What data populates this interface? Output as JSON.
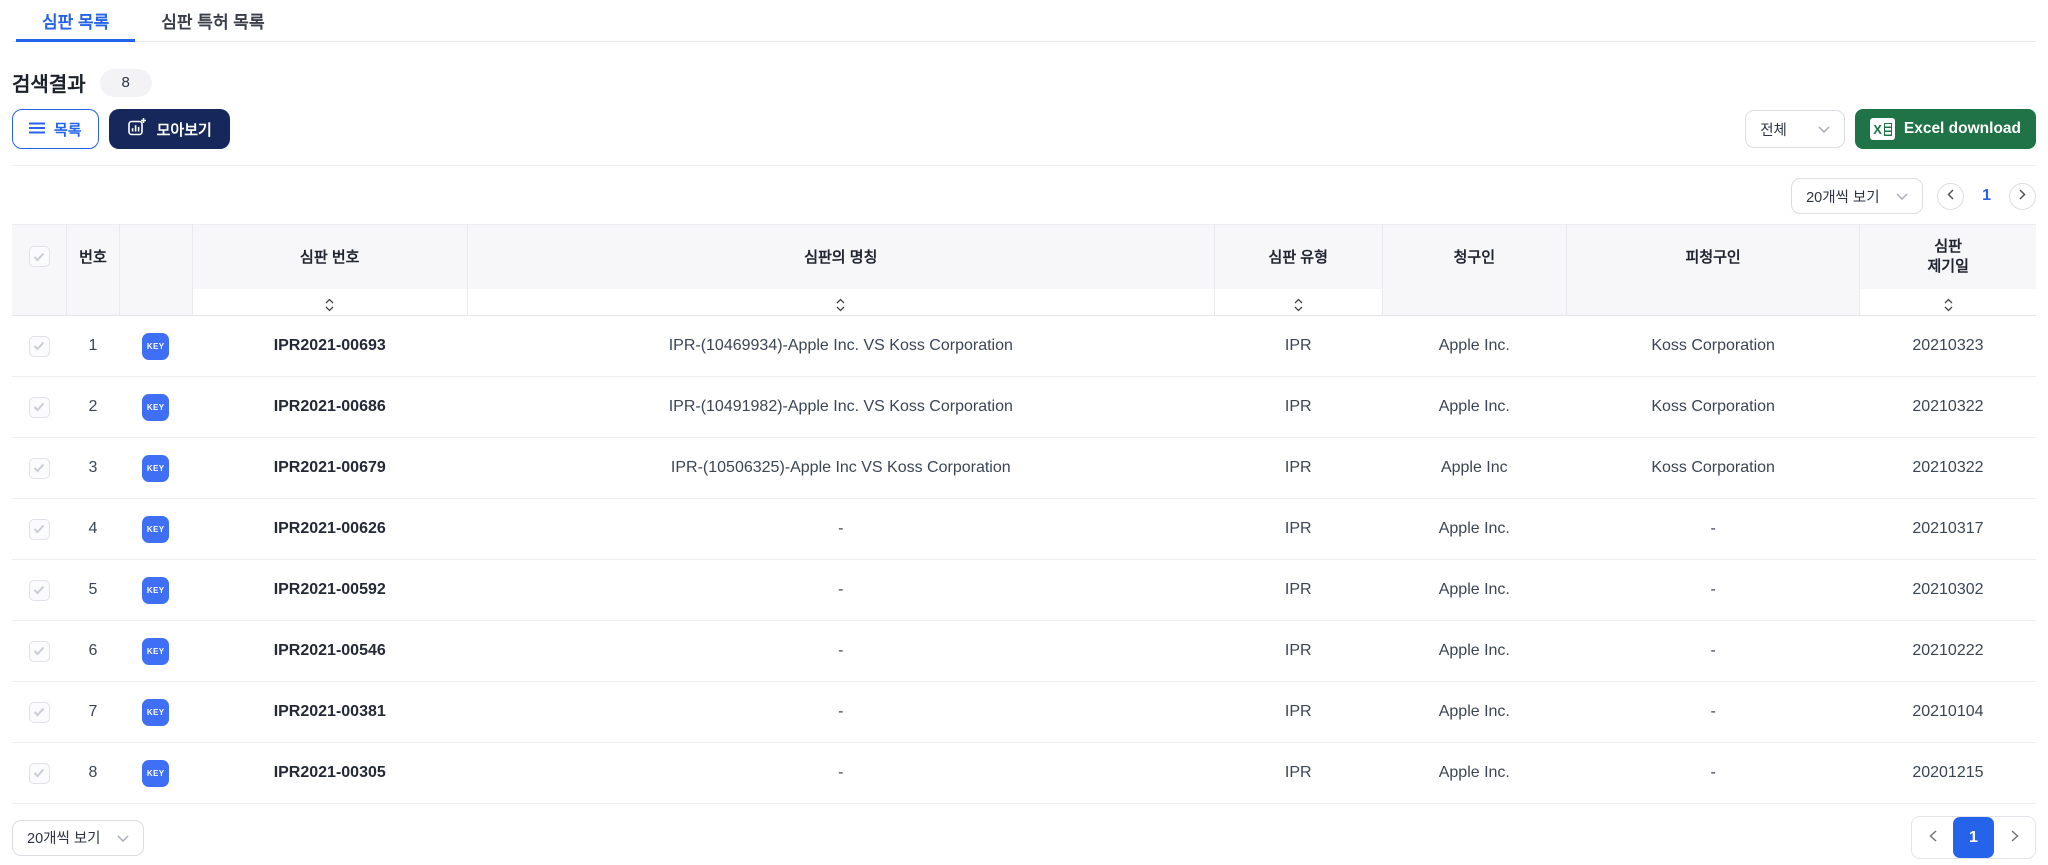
{
  "tabs": [
    {
      "label": "심판 목록",
      "active": true
    },
    {
      "label": "심판 특허 목록",
      "active": false
    }
  ],
  "results": {
    "label": "검색결과",
    "count": "8"
  },
  "toolbar": {
    "list_button": "목록",
    "collect_button": "모아보기",
    "filter_select_value": "전체",
    "excel_button": "Excel download"
  },
  "pagination_top": {
    "page_size_value": "20개씩 보기",
    "current_page": "1"
  },
  "table": {
    "headers": {
      "number": "번호",
      "trial_number": "심판 번호",
      "trial_title": "심판의 명칭",
      "trial_type": "심판 유형",
      "claimant": "청구인",
      "respondent": "피청구인",
      "filing_date_line1": "심판",
      "filing_date_line2": "제기일"
    },
    "rows": [
      {
        "no": "1",
        "badge": "KEY",
        "case_no": "IPR2021-00693",
        "title": "IPR-(10469934)-Apple Inc. VS Koss Corporation",
        "type": "IPR",
        "claimant": "Apple Inc.",
        "respondent": "Koss Corporation",
        "date": "20210323"
      },
      {
        "no": "2",
        "badge": "KEY",
        "case_no": "IPR2021-00686",
        "title": "IPR-(10491982)-Apple Inc. VS Koss Corporation",
        "type": "IPR",
        "claimant": "Apple Inc.",
        "respondent": "Koss Corporation",
        "date": "20210322"
      },
      {
        "no": "3",
        "badge": "KEY",
        "case_no": "IPR2021-00679",
        "title": "IPR-(10506325)-Apple Inc VS Koss Corporation",
        "type": "IPR",
        "claimant": "Apple Inc",
        "respondent": "Koss Corporation",
        "date": "20210322"
      },
      {
        "no": "4",
        "badge": "KEY",
        "case_no": "IPR2021-00626",
        "title": "-",
        "type": "IPR",
        "claimant": "Apple Inc.",
        "respondent": "-",
        "date": "20210317"
      },
      {
        "no": "5",
        "badge": "KEY",
        "case_no": "IPR2021-00592",
        "title": "-",
        "type": "IPR",
        "claimant": "Apple Inc.",
        "respondent": "-",
        "date": "20210302"
      },
      {
        "no": "6",
        "badge": "KEY",
        "case_no": "IPR2021-00546",
        "title": "-",
        "type": "IPR",
        "claimant": "Apple Inc.",
        "respondent": "-",
        "date": "20210222"
      },
      {
        "no": "7",
        "badge": "KEY",
        "case_no": "IPR2021-00381",
        "title": "-",
        "type": "IPR",
        "claimant": "Apple Inc.",
        "respondent": "-",
        "date": "20210104"
      },
      {
        "no": "8",
        "badge": "KEY",
        "case_no": "IPR2021-00305",
        "title": "-",
        "type": "IPR",
        "claimant": "Apple Inc.",
        "respondent": "-",
        "date": "20201215"
      }
    ]
  },
  "pagination_bottom": {
    "page_size_value": "20개씩 보기",
    "current_page": "1"
  },
  "icons": {
    "list_button_icon": "hamburger-lines",
    "collect_button_icon": "bar-chart-plus",
    "excel_button_icon": "excel-sheet",
    "select_icon": "chevron-down",
    "sort_icon": "caret-up-down",
    "checkbox_icon": "gray-check"
  },
  "colors": {
    "accent_blue": "#2563eb",
    "badge_blue": "#3e6ff4",
    "navy": "#16275c",
    "excel_green": "#1f7346",
    "header_bg": "#f7f7f9"
  }
}
